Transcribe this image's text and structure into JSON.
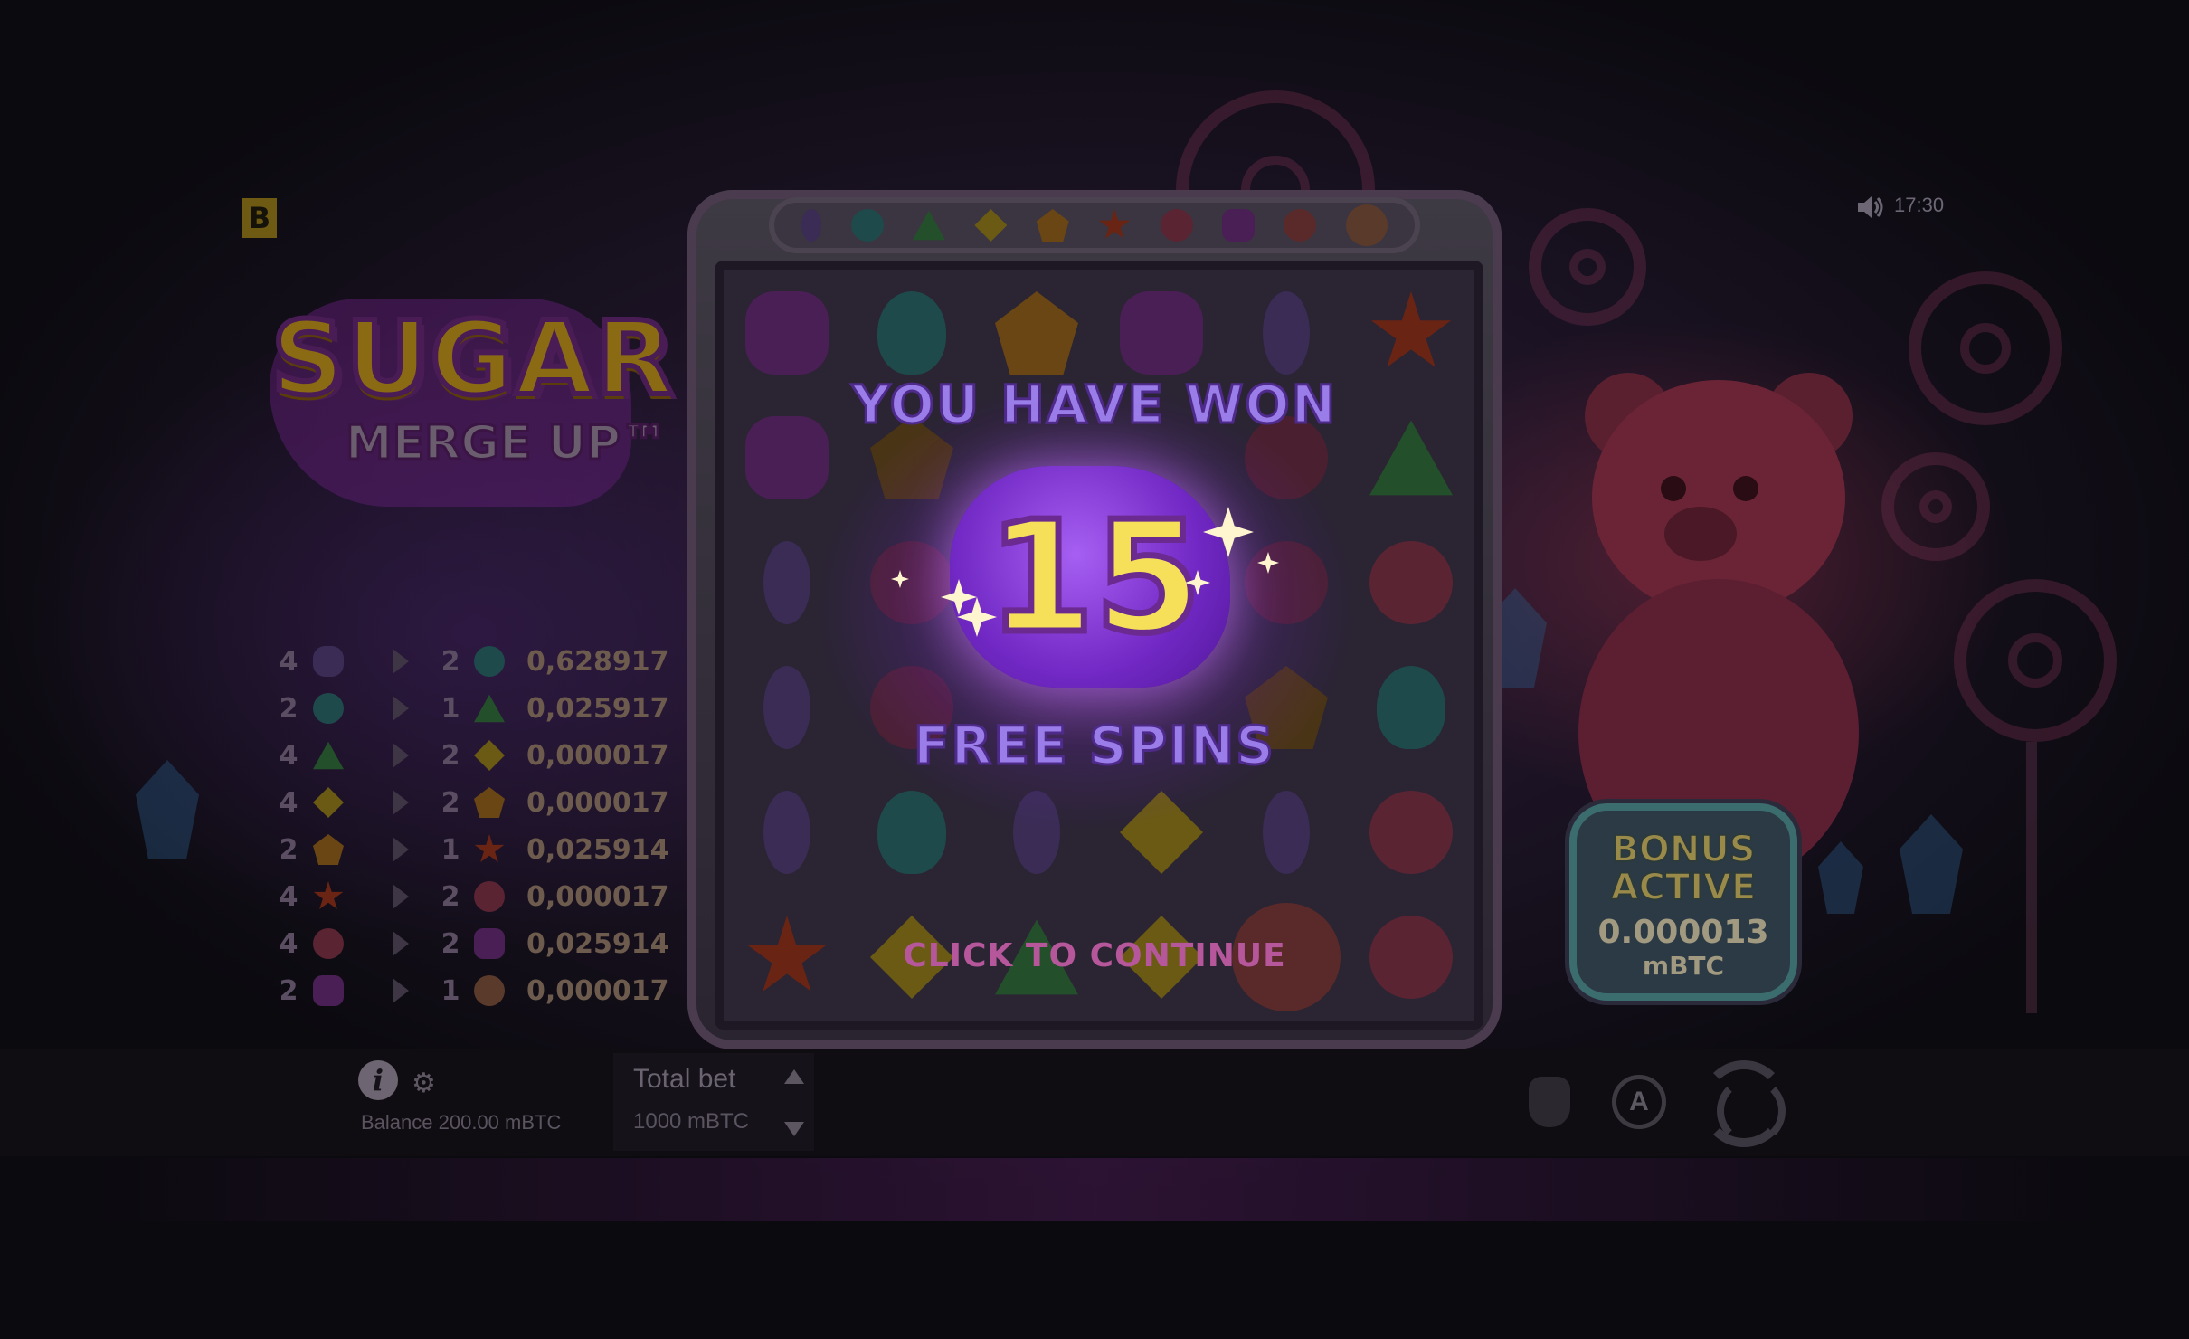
{
  "header": {
    "brand_logo": "B",
    "sound_icon": "speaker-icon",
    "clock": "17:30"
  },
  "game_logo": {
    "line1": "SUGAR",
    "line2": "MERGE UP™"
  },
  "paytable": [
    {
      "count_from": "4",
      "from_symbol": "purple-jellybean",
      "count_to": "2",
      "to_symbol": "teal-drop",
      "value": "0,628917"
    },
    {
      "count_from": "2",
      "from_symbol": "teal-drop",
      "count_to": "1",
      "to_symbol": "green-triangle",
      "value": "0,025917"
    },
    {
      "count_from": "4",
      "from_symbol": "green-triangle",
      "count_to": "2",
      "to_symbol": "yellow-diamond",
      "value": "0,000017"
    },
    {
      "count_from": "4",
      "from_symbol": "yellow-diamond",
      "count_to": "2",
      "to_symbol": "orange-pentagon",
      "value": "0,000017"
    },
    {
      "count_from": "2",
      "from_symbol": "orange-pentagon",
      "count_to": "1",
      "to_symbol": "red-star",
      "value": "0,025914"
    },
    {
      "count_from": "4",
      "from_symbol": "red-star",
      "count_to": "2",
      "to_symbol": "pink-flower",
      "value": "0,000017"
    },
    {
      "count_from": "4",
      "from_symbol": "pink-flower",
      "count_to": "2",
      "to_symbol": "purple-bear",
      "value": "0,025914"
    },
    {
      "count_from": "2",
      "from_symbol": "purple-bear",
      "count_to": "1",
      "to_symbol": "scatter-lollipop",
      "value": "0,000017"
    }
  ],
  "colors": {
    "purple-jellybean": "#3a2c55",
    "teal-drop": "#1e4a4c",
    "green-triangle": "#23502a",
    "yellow-diamond": "#6a5a14",
    "orange-pentagon": "#6a4614",
    "red-star": "#6a2414",
    "pink-flower": "#5a2433",
    "purple-bear": "#4a1f55",
    "scatter-lollipop": "#5a3a2a",
    "accent": "#9a7de8"
  },
  "win_popup": {
    "title": "YOU HAVE WON",
    "count": "15",
    "subtitle": "FREE SPINS",
    "continue_label": "CLICK TO CONTINUE"
  },
  "bonus_badge": {
    "line1": "BONUS",
    "line2": "ACTIVE",
    "amount": "0.000013",
    "unit": "mBTC"
  },
  "footer": {
    "balance": "Balance 200.00 mBTC",
    "total_bet_label": "Total bet",
    "total_bet_value": "1000 mBTC"
  }
}
